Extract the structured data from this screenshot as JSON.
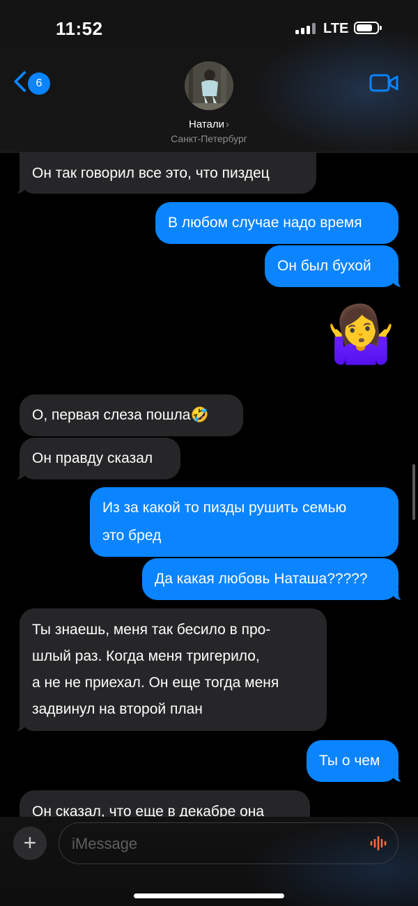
{
  "status_bar": {
    "time": "11:52",
    "network": "LTE"
  },
  "header": {
    "back_badge": "6",
    "contact_name": "Натали",
    "contact_subtitle": "Санкт-Петербург",
    "avatar_icon": "contact-photo",
    "video_icon": "video-camera-icon"
  },
  "messages": [
    {
      "direction": "incoming",
      "text": "Он так говорил все это, что пиздец"
    },
    {
      "direction": "outgoing",
      "text": "В любом случае надо время"
    },
    {
      "direction": "outgoing",
      "text": "Он был бухой"
    },
    {
      "direction": "outgoing",
      "text": "🤷‍♀️",
      "type": "emoji"
    },
    {
      "direction": "incoming",
      "text": "О, первая слеза пошла🤣"
    },
    {
      "direction": "incoming",
      "text": "Он правду сказал"
    },
    {
      "direction": "outgoing",
      "text": "Из за какой то пизды рушить семью это бред"
    },
    {
      "direction": "outgoing",
      "text": "Да какая любовь Наташа?????"
    },
    {
      "direction": "incoming",
      "text": "Ты знаешь, меня так бесило в прошлый раз. Когда меня тригерило, а не не приехал. Он еще тогда меня задвинул на второй план"
    },
    {
      "direction": "outgoing",
      "text": "Ты о чем"
    },
    {
      "direction": "incoming",
      "text": "Он сказал, что еще в декабре она"
    }
  ],
  "multiline": {
    "m6": [
      "Из за какой то пизды рушить семью",
      "это бред"
    ],
    "m8": [
      "Ты знаешь, меня так бесило в про-",
      "шлый раз. Когда меня тригерило,",
      "а не не приехал. Он еще тогда меня",
      "задвинул на второй план"
    ]
  },
  "composer": {
    "placeholder": "iMessage",
    "add_icon": "plus-icon",
    "voice_icon": "waveform-icon"
  },
  "colors": {
    "outgoing_bubble": "#0a84ff",
    "incoming_bubble": "#262628",
    "background": "#000000"
  }
}
